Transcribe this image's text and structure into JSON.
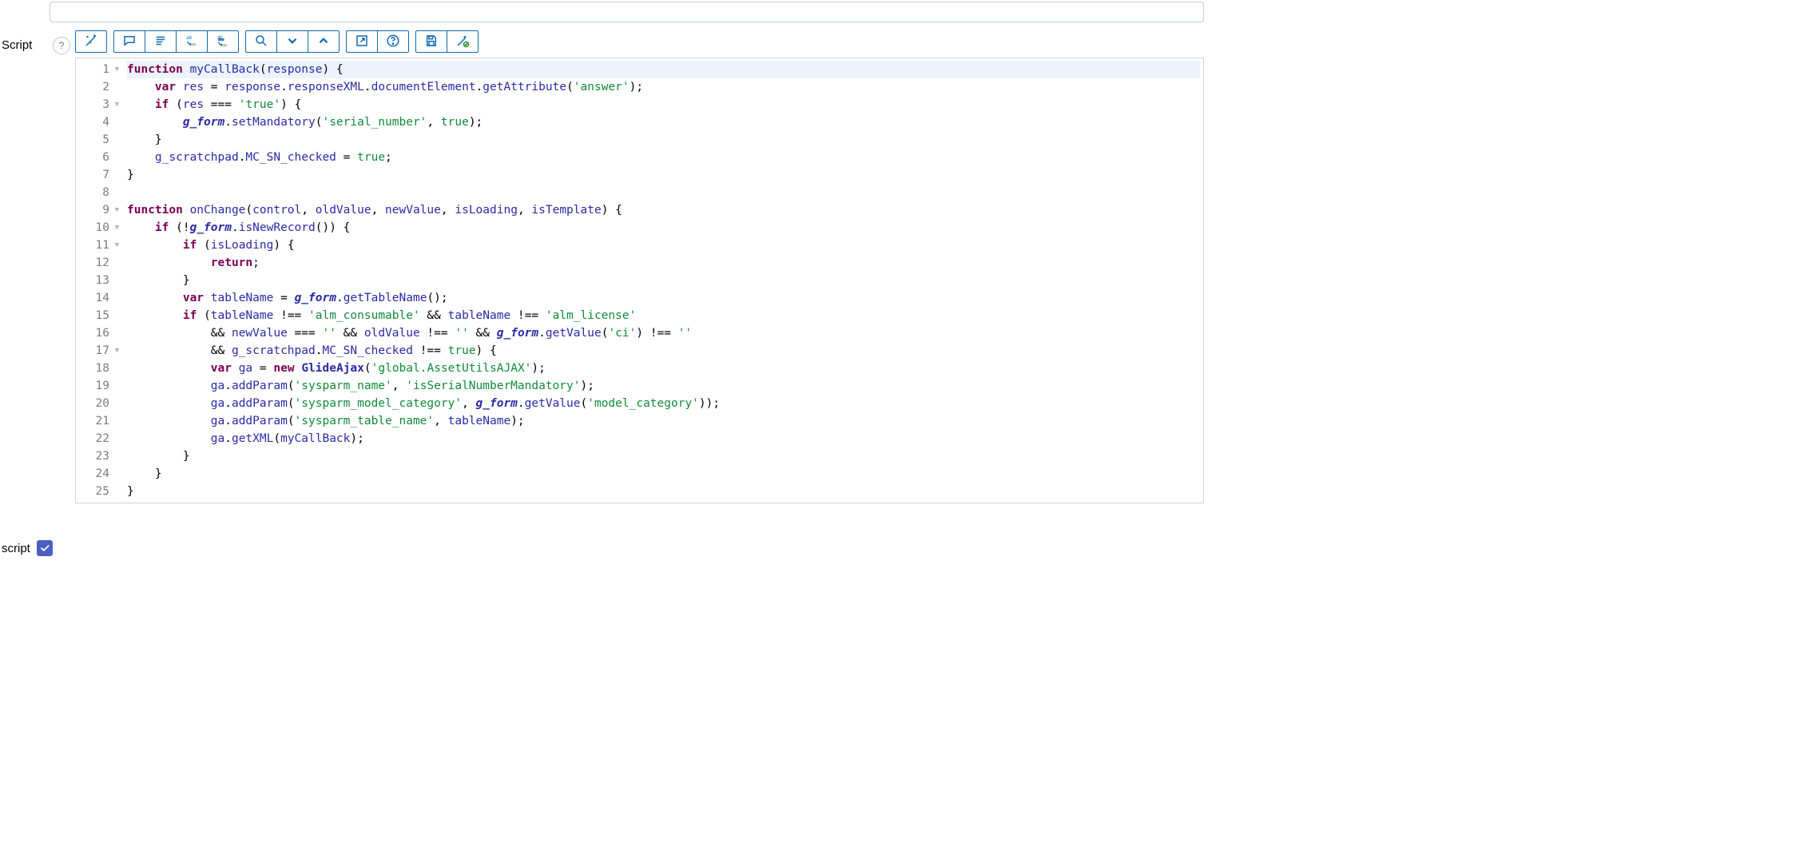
{
  "labels": {
    "script": "Script",
    "footer": "script"
  },
  "toolbar": {
    "format_code": "Format code",
    "toggle_comment": "Toggle comment",
    "show_description": "Show description",
    "replace": "Replace",
    "replace_all": "Replace all",
    "search": "Search",
    "scroll_down": "Scroll down",
    "scroll_up": "Scroll up",
    "fullscreen": "Open fullscreen",
    "help": "Help",
    "save": "Save",
    "syntax_check": "Syntax check"
  },
  "footer_checked": true,
  "code_lines": [
    {
      "n": 1,
      "fold": true,
      "indent": 0,
      "tokens": [
        [
          "kw",
          "function"
        ],
        [
          "pun",
          " "
        ],
        [
          "fn",
          "myCallBack"
        ],
        [
          "pun",
          "("
        ],
        [
          "id",
          "response"
        ],
        [
          "pun",
          ") {"
        ]
      ]
    },
    {
      "n": 2,
      "indent": 1,
      "tokens": [
        [
          "kw",
          "var"
        ],
        [
          "pun",
          " "
        ],
        [
          "id",
          "res"
        ],
        [
          "pun",
          " = "
        ],
        [
          "id",
          "response"
        ],
        [
          "pun",
          "."
        ],
        [
          "id",
          "responseXML"
        ],
        [
          "pun",
          "."
        ],
        [
          "id",
          "documentElement"
        ],
        [
          "pun",
          "."
        ],
        [
          "id",
          "getAttribute"
        ],
        [
          "pun",
          "("
        ],
        [
          "str",
          "'answer'"
        ],
        [
          "pun",
          ");"
        ]
      ]
    },
    {
      "n": 3,
      "fold": true,
      "indent": 1,
      "tokens": [
        [
          "kw",
          "if"
        ],
        [
          "pun",
          " ("
        ],
        [
          "id",
          "res"
        ],
        [
          "pun",
          " === "
        ],
        [
          "str",
          "'true'"
        ],
        [
          "pun",
          ") {"
        ]
      ]
    },
    {
      "n": 4,
      "indent": 2,
      "tokens": [
        [
          "it bld id",
          "g_form"
        ],
        [
          "pun",
          "."
        ],
        [
          "id",
          "setMandatory"
        ],
        [
          "pun",
          "("
        ],
        [
          "str",
          "'serial_number'"
        ],
        [
          "pun",
          ", "
        ],
        [
          "num",
          "true"
        ],
        [
          "pun",
          ");"
        ]
      ]
    },
    {
      "n": 5,
      "indent": 1,
      "tokens": [
        [
          "pun",
          "}"
        ]
      ]
    },
    {
      "n": 6,
      "indent": 1,
      "tokens": [
        [
          "id",
          "g_scratchpad"
        ],
        [
          "pun",
          "."
        ],
        [
          "id",
          "MC_SN_checked"
        ],
        [
          "pun",
          " = "
        ],
        [
          "num",
          "true"
        ],
        [
          "pun",
          ";"
        ]
      ]
    },
    {
      "n": 7,
      "indent": 0,
      "tokens": [
        [
          "pun",
          "}"
        ]
      ]
    },
    {
      "n": 8,
      "indent": 0,
      "tokens": []
    },
    {
      "n": 9,
      "fold": true,
      "indent": 0,
      "tokens": [
        [
          "kw",
          "function"
        ],
        [
          "pun",
          " "
        ],
        [
          "fn",
          "onChange"
        ],
        [
          "pun",
          "("
        ],
        [
          "id",
          "control"
        ],
        [
          "pun",
          ", "
        ],
        [
          "id",
          "oldValue"
        ],
        [
          "pun",
          ", "
        ],
        [
          "id",
          "newValue"
        ],
        [
          "pun",
          ", "
        ],
        [
          "id",
          "isLoading"
        ],
        [
          "pun",
          ", "
        ],
        [
          "id",
          "isTemplate"
        ],
        [
          "pun",
          ") {"
        ]
      ]
    },
    {
      "n": 10,
      "fold": true,
      "indent": 1,
      "tokens": [
        [
          "kw",
          "if"
        ],
        [
          "pun",
          " (!"
        ],
        [
          "it bld id",
          "g_form"
        ],
        [
          "pun",
          "."
        ],
        [
          "id",
          "isNewRecord"
        ],
        [
          "pun",
          "()) {"
        ]
      ]
    },
    {
      "n": 11,
      "fold": true,
      "indent": 2,
      "tokens": [
        [
          "kw",
          "if"
        ],
        [
          "pun",
          " ("
        ],
        [
          "id",
          "isLoading"
        ],
        [
          "pun",
          ") {"
        ]
      ]
    },
    {
      "n": 12,
      "indent": 3,
      "tokens": [
        [
          "kw",
          "return"
        ],
        [
          "pun",
          ";"
        ]
      ]
    },
    {
      "n": 13,
      "indent": 2,
      "tokens": [
        [
          "pun",
          "}"
        ]
      ]
    },
    {
      "n": 14,
      "indent": 2,
      "tokens": [
        [
          "kw",
          "var"
        ],
        [
          "pun",
          " "
        ],
        [
          "id",
          "tableName"
        ],
        [
          "pun",
          " = "
        ],
        [
          "it bld id",
          "g_form"
        ],
        [
          "pun",
          "."
        ],
        [
          "id",
          "getTableName"
        ],
        [
          "pun",
          "();"
        ]
      ]
    },
    {
      "n": 15,
      "indent": 2,
      "tokens": [
        [
          "kw",
          "if"
        ],
        [
          "pun",
          " ("
        ],
        [
          "id",
          "tableName"
        ],
        [
          "pun",
          " !== "
        ],
        [
          "str",
          "'alm_consumable'"
        ],
        [
          "pun",
          " && "
        ],
        [
          "id",
          "tableName"
        ],
        [
          "pun",
          " !== "
        ],
        [
          "str",
          "'alm_license'"
        ]
      ]
    },
    {
      "n": 16,
      "indent": 3,
      "tokens": [
        [
          "pun",
          "&& "
        ],
        [
          "id",
          "newValue"
        ],
        [
          "pun",
          " === "
        ],
        [
          "str",
          "''"
        ],
        [
          "pun",
          " && "
        ],
        [
          "id",
          "oldValue"
        ],
        [
          "pun",
          " !== "
        ],
        [
          "str",
          "''"
        ],
        [
          "pun",
          " && "
        ],
        [
          "it bld id",
          "g_form"
        ],
        [
          "pun",
          "."
        ],
        [
          "id",
          "getValue"
        ],
        [
          "pun",
          "("
        ],
        [
          "str",
          "'ci'"
        ],
        [
          "pun",
          ") !== "
        ],
        [
          "str",
          "''"
        ]
      ]
    },
    {
      "n": 17,
      "fold": true,
      "indent": 3,
      "tokens": [
        [
          "pun",
          "&& "
        ],
        [
          "id",
          "g_scratchpad"
        ],
        [
          "pun",
          "."
        ],
        [
          "id",
          "MC_SN_checked"
        ],
        [
          "pun",
          " !== "
        ],
        [
          "num",
          "true"
        ],
        [
          "pun",
          ") {"
        ]
      ]
    },
    {
      "n": 18,
      "indent": 3,
      "tokens": [
        [
          "kw",
          "var"
        ],
        [
          "pun",
          " "
        ],
        [
          "id",
          "ga"
        ],
        [
          "pun",
          " = "
        ],
        [
          "kw",
          "new"
        ],
        [
          "pun",
          " "
        ],
        [
          "bld fn",
          "GlideAjax"
        ],
        [
          "pun",
          "("
        ],
        [
          "str",
          "'global.AssetUtilsAJAX'"
        ],
        [
          "pun",
          ");"
        ]
      ]
    },
    {
      "n": 19,
      "indent": 3,
      "tokens": [
        [
          "id",
          "ga"
        ],
        [
          "pun",
          "."
        ],
        [
          "id",
          "addParam"
        ],
        [
          "pun",
          "("
        ],
        [
          "str",
          "'sysparm_name'"
        ],
        [
          "pun",
          ", "
        ],
        [
          "str",
          "'isSerialNumberMandatory'"
        ],
        [
          "pun",
          ");"
        ]
      ]
    },
    {
      "n": 20,
      "indent": 3,
      "tokens": [
        [
          "id",
          "ga"
        ],
        [
          "pun",
          "."
        ],
        [
          "id",
          "addParam"
        ],
        [
          "pun",
          "("
        ],
        [
          "str",
          "'sysparm_model_category'"
        ],
        [
          "pun",
          ", "
        ],
        [
          "it bld id",
          "g_form"
        ],
        [
          "pun",
          "."
        ],
        [
          "id",
          "getValue"
        ],
        [
          "pun",
          "("
        ],
        [
          "str",
          "'model_category'"
        ],
        [
          "pun",
          "));"
        ]
      ]
    },
    {
      "n": 21,
      "indent": 3,
      "tokens": [
        [
          "id",
          "ga"
        ],
        [
          "pun",
          "."
        ],
        [
          "id",
          "addParam"
        ],
        [
          "pun",
          "("
        ],
        [
          "str",
          "'sysparm_table_name'"
        ],
        [
          "pun",
          ", "
        ],
        [
          "id",
          "tableName"
        ],
        [
          "pun",
          ");"
        ]
      ]
    },
    {
      "n": 22,
      "indent": 3,
      "tokens": [
        [
          "id",
          "ga"
        ],
        [
          "pun",
          "."
        ],
        [
          "id",
          "getXML"
        ],
        [
          "pun",
          "("
        ],
        [
          "id",
          "myCallBack"
        ],
        [
          "pun",
          ");"
        ]
      ]
    },
    {
      "n": 23,
      "indent": 2,
      "tokens": [
        [
          "pun",
          "}"
        ]
      ]
    },
    {
      "n": 24,
      "indent": 1,
      "tokens": [
        [
          "pun",
          "}"
        ]
      ]
    },
    {
      "n": 25,
      "indent": 0,
      "tokens": [
        [
          "pun",
          "}"
        ]
      ]
    }
  ]
}
